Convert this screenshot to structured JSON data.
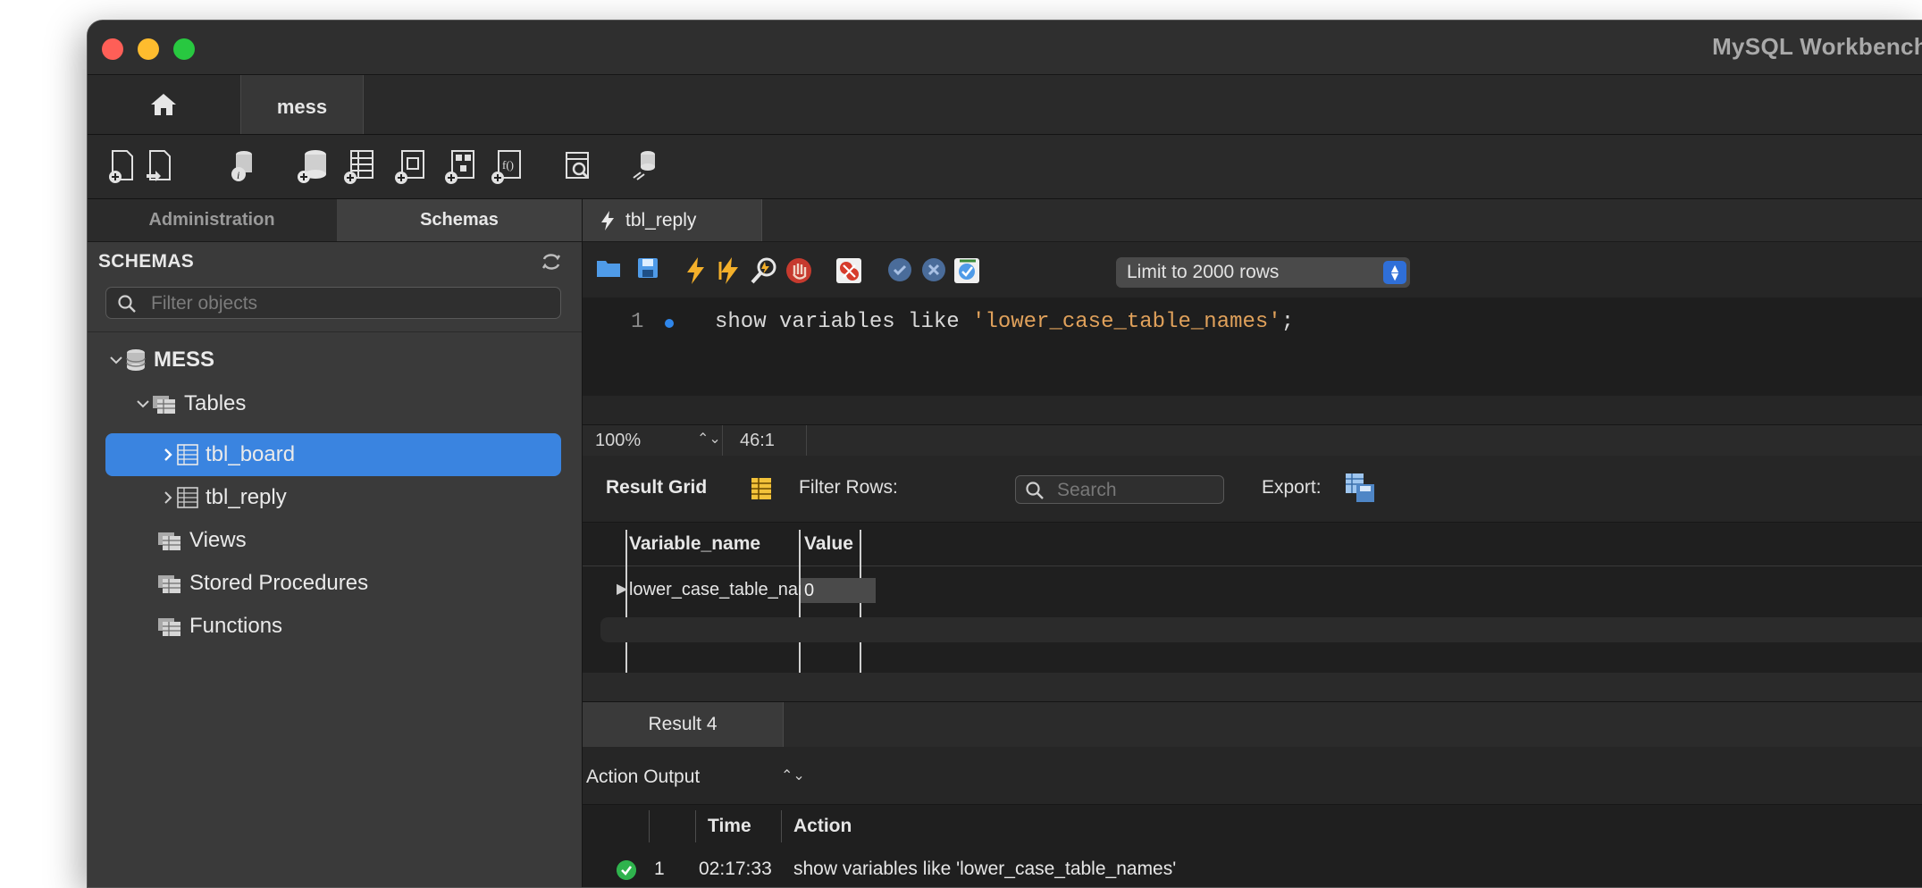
{
  "window": {
    "title": "MySQL Workbench"
  },
  "tabs": {
    "connection_tab": "mess"
  },
  "sidebar": {
    "tabs": {
      "administration": "Administration",
      "schemas": "Schemas"
    },
    "header": "SCHEMAS",
    "filter_placeholder": "Filter objects",
    "tree": {
      "schema": "MESS",
      "tables": "Tables",
      "table_1": "tbl_board",
      "table_2": "tbl_reply",
      "views": "Views",
      "procedures": "Stored Procedures",
      "functions": "Functions"
    }
  },
  "editor": {
    "tab_label": "tbl_reply",
    "limit_select": "Limit to 2000 rows",
    "line_number": "1",
    "code_plain": "show variables like ",
    "code_string": "'lower_case_table_names'",
    "code_end": ";",
    "zoom": "100%",
    "cursor_pos": "46:1"
  },
  "result_grid": {
    "label": "Result Grid",
    "filter_label": "Filter Rows:",
    "search_placeholder": "Search",
    "export_label": "Export:",
    "columns": [
      "Variable_name",
      "Value"
    ],
    "rows": [
      {
        "variable_name": "lower_case_table_names",
        "value": "0"
      }
    ]
  },
  "result_tab": "Result 4",
  "output": {
    "mode_label": "Action Output",
    "columns": {
      "time": "Time",
      "action": "Action"
    },
    "rows": [
      {
        "index": "1",
        "time": "02:17:33",
        "action": "show variables like 'lower_case_table_names'"
      }
    ]
  },
  "colors": {
    "selection": "#3a84e0",
    "code_string": "#e0a15b",
    "success": "#2fb34d"
  }
}
